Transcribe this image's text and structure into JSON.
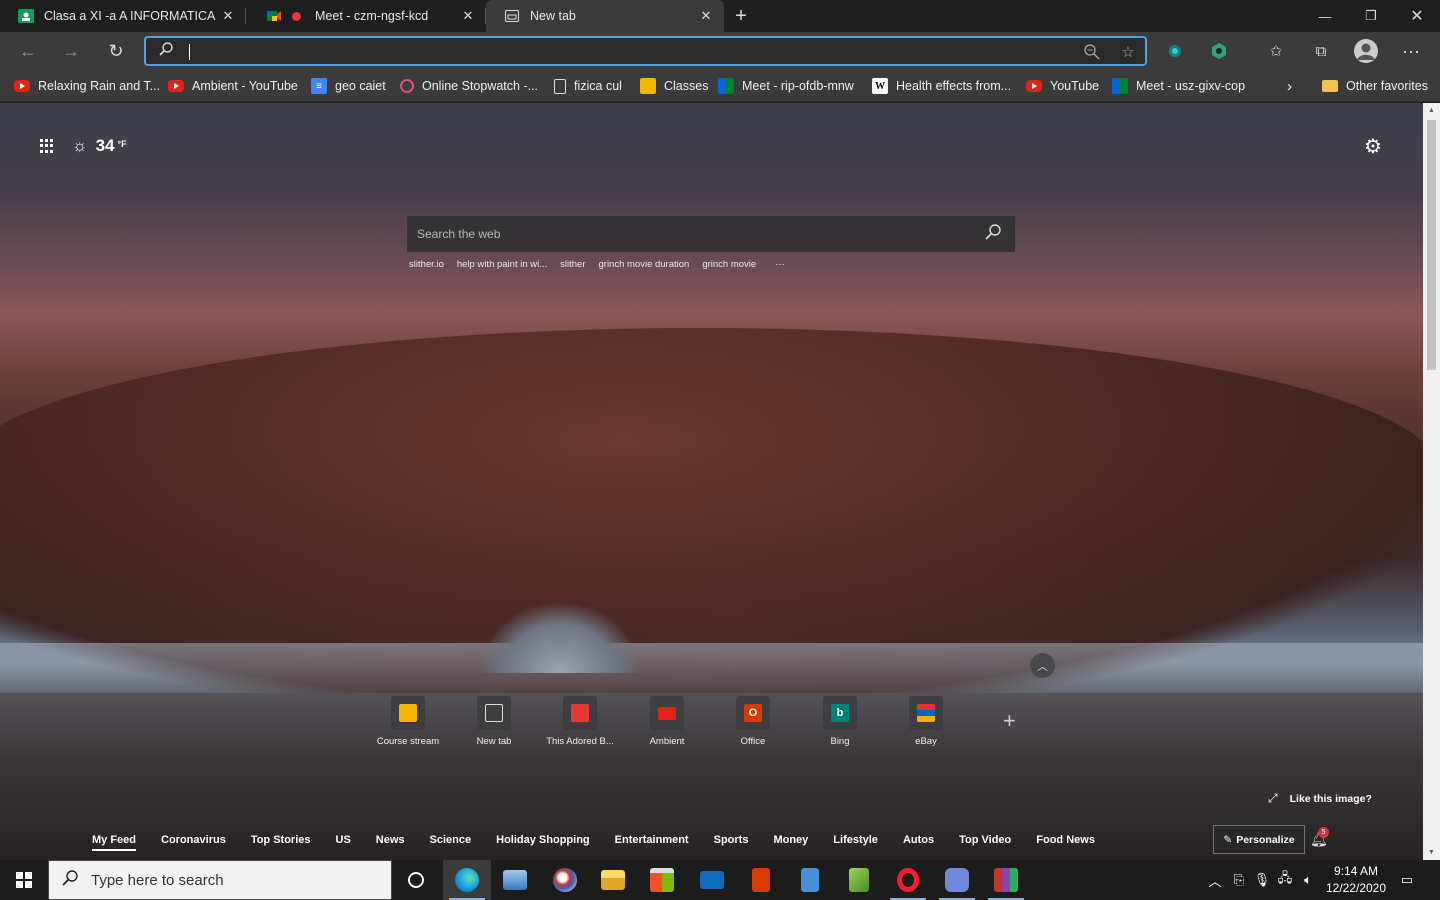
{
  "tabs": [
    {
      "title": "Clasa a XI -a A INFORMATICA",
      "icon": "classroom-icon"
    },
    {
      "title": "Meet - czm-ngsf-kcd",
      "icon": "meet-icon",
      "recording": true
    },
    {
      "title": "New tab",
      "icon": "newtab-icon",
      "active": true
    }
  ],
  "address_bar": {
    "value": "",
    "placeholder": ""
  },
  "favorites": [
    {
      "label": "Relaxing Rain and T...",
      "icon": "youtube-icon"
    },
    {
      "label": "Ambient - YouTube",
      "icon": "youtube-icon"
    },
    {
      "label": "geo caiet",
      "icon": "docs-icon"
    },
    {
      "label": "Online Stopwatch -...",
      "icon": "stopwatch-icon"
    },
    {
      "label": "fizica cul",
      "icon": "page-icon"
    },
    {
      "label": "Classes",
      "icon": "classroom-icon"
    },
    {
      "label": "Meet - rip-ofdb-mnw",
      "icon": "meet-icon"
    },
    {
      "label": "Health effects from...",
      "icon": "wikipedia-icon"
    },
    {
      "label": "YouTube",
      "icon": "youtube-icon"
    },
    {
      "label": "Meet - usz-gixv-cop",
      "icon": "meet-icon"
    },
    {
      "label": "Other favorites",
      "icon": "folder-icon"
    }
  ],
  "weather": {
    "temp": "34",
    "unit": "°F",
    "icon": "sun-icon"
  },
  "search": {
    "placeholder": "Search the web",
    "suggestions": [
      "slither.io",
      "help with paint in wi...",
      "slither",
      "grinch movie duration",
      "grinch movie",
      "···"
    ]
  },
  "quick_links": [
    {
      "label": "Course stream",
      "color": "#f4b400"
    },
    {
      "label": "New tab",
      "color": "#555555"
    },
    {
      "label": "This Adored B...",
      "color": "#e53935"
    },
    {
      "label": "Ambient",
      "color": "#e62117"
    },
    {
      "label": "Office",
      "color": "#d83b01"
    },
    {
      "label": "Bing",
      "color": "#008373"
    },
    {
      "label": "eBay",
      "color": "#2a2a2a"
    }
  ],
  "like_image": "Like this image?",
  "feed_nav": [
    "My Feed",
    "Coronavirus",
    "Top Stories",
    "US",
    "News",
    "Science",
    "Holiday Shopping",
    "Entertainment",
    "Sports",
    "Money",
    "Lifestyle",
    "Autos",
    "Top Video",
    "Food News"
  ],
  "personalize": "Personalize",
  "notifications": "5",
  "taskbar": {
    "search_placeholder": "Type here to search",
    "apps": [
      "cortana-icon",
      "edge-icon",
      "control-panel-icon",
      "paint-icon",
      "file-explorer-icon",
      "store-icon",
      "mail-icon",
      "office-icon",
      "calculator-icon",
      "notepad-icon",
      "opera-icon",
      "discord-icon",
      "winrar-icon"
    ],
    "time": "9:14 AM",
    "date": "12/22/2020"
  }
}
